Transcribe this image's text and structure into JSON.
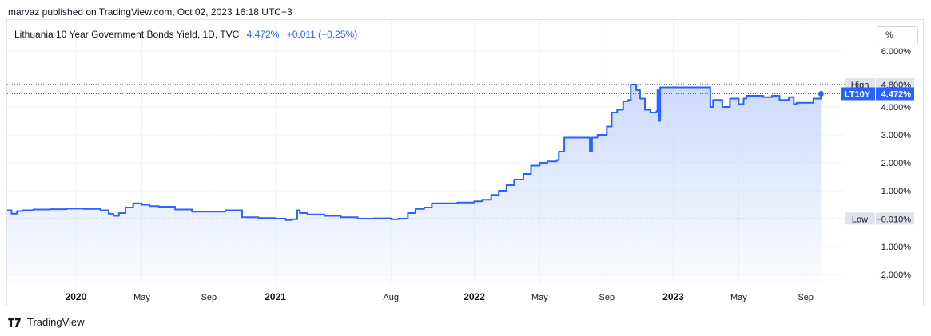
{
  "header": {
    "published": "marvaz published on TradingView.com, Oct 02, 2023 16:18 UTC+3"
  },
  "legend": {
    "name": "Lithuania 10 Year Government Bonds Yield, 1D, TVC",
    "value": "4.472%",
    "change": "+0.011 (+0.25%)"
  },
  "scale_button": "%",
  "footer": {
    "brand": "TradingView"
  },
  "colors": {
    "line": "#2962ff",
    "area_top": "#c3d3fa",
    "grid": "#f0f3fa",
    "label_bg": "#e0e3eb"
  },
  "chart_data": {
    "type": "area",
    "symbol": "LT10Y",
    "title": "Lithuania 10 Year Government Bonds Yield, 1D, TVC",
    "y_unit": "%",
    "ylim": [
      -2.3,
      6.3
    ],
    "y_ticks": [
      "6.000%",
      "4.000%",
      "3.000%",
      "2.000%",
      "1.000%",
      "−1.000%",
      "−2.000%"
    ],
    "y_tick_values": [
      6,
      4,
      3,
      2,
      1,
      -1,
      -2
    ],
    "x_ticks": [
      "2020",
      "May",
      "Sep",
      "2021",
      "Aug",
      "2022",
      "May",
      "Sep",
      "2023",
      "May",
      "Sep"
    ],
    "x_tick_dates": [
      "2020-01-01",
      "2020-05-01",
      "2020-09-01",
      "2021-01-01",
      "2021-08-01",
      "2022-01-01",
      "2022-05-01",
      "2022-09-01",
      "2023-01-01",
      "2023-05-01",
      "2023-09-01"
    ],
    "x_bold_ticks": [
      "2020",
      "2021",
      "2022",
      "2023"
    ],
    "xlim": [
      "2019-08-28",
      "2023-11-10"
    ],
    "high": {
      "label": "High",
      "value": "4.800%",
      "y": 4.8
    },
    "low": {
      "label": "Low",
      "value": "−0.010%",
      "y": -0.01
    },
    "last": {
      "label": "LT10Y",
      "value": "4.472%",
      "y": 4.472,
      "date": "2023-09-29"
    },
    "series": [
      {
        "x": [
          "2019-08-28",
          "2019-09-05",
          "2019-09-15",
          "2019-09-25",
          "2019-10-15",
          "2019-11-15",
          "2019-12-15",
          "2020-01-15",
          "2020-02-15",
          "2020-03-01",
          "2020-03-10",
          "2020-03-20",
          "2020-04-01",
          "2020-04-15",
          "2020-05-01",
          "2020-05-15",
          "2020-06-01",
          "2020-07-01",
          "2020-08-01",
          "2020-09-01",
          "2020-10-01",
          "2020-10-20",
          "2020-11-01",
          "2020-12-01",
          "2021-01-01",
          "2021-01-20",
          "2021-02-01",
          "2021-02-10",
          "2021-02-15",
          "2021-03-01",
          "2021-04-01",
          "2021-05-01",
          "2021-06-01",
          "2021-07-01",
          "2021-08-01",
          "2021-08-15",
          "2021-09-01",
          "2021-09-15",
          "2021-10-01",
          "2021-10-15",
          "2021-11-01",
          "2021-12-01",
          "2022-01-01",
          "2022-01-15",
          "2022-02-01",
          "2022-02-15",
          "2022-03-01",
          "2022-03-15",
          "2022-04-01",
          "2022-04-15",
          "2022-05-01",
          "2022-05-15",
          "2022-06-01",
          "2022-06-05",
          "2022-06-15",
          "2022-07-01",
          "2022-07-10",
          "2022-08-01",
          "2022-08-05",
          "2022-08-15",
          "2022-09-01",
          "2022-09-10",
          "2022-09-20",
          "2022-10-01",
          "2022-10-10",
          "2022-10-15",
          "2022-10-18",
          "2022-10-25",
          "2022-11-01",
          "2022-11-10",
          "2022-11-20",
          "2022-12-01",
          "2022-12-03",
          "2022-12-05",
          "2022-12-08",
          "2022-12-10",
          "2022-12-12",
          "2022-12-15",
          "2023-01-01",
          "2023-02-01",
          "2023-03-01",
          "2023-03-10",
          "2023-03-15",
          "2023-04-01",
          "2023-04-15",
          "2023-05-01",
          "2023-05-10",
          "2023-05-15",
          "2023-06-01",
          "2023-06-15",
          "2023-07-01",
          "2023-07-15",
          "2023-08-01",
          "2023-08-10",
          "2023-08-15",
          "2023-09-01",
          "2023-09-15",
          "2023-09-29"
        ],
        "y": [
          0.3,
          0.18,
          0.27,
          0.3,
          0.33,
          0.34,
          0.36,
          0.35,
          0.3,
          0.18,
          0.1,
          0.2,
          0.4,
          0.55,
          0.5,
          0.45,
          0.43,
          0.33,
          0.25,
          0.25,
          0.3,
          0.3,
          0.05,
          0.02,
          0.0,
          -0.05,
          -0.02,
          0.3,
          0.2,
          0.15,
          0.1,
          0.05,
          0.0,
          0.01,
          -0.02,
          0.0,
          0.2,
          0.35,
          0.4,
          0.55,
          0.55,
          0.58,
          0.62,
          0.68,
          0.85,
          1.0,
          1.2,
          1.4,
          1.6,
          1.9,
          2.0,
          2.05,
          2.1,
          2.4,
          2.9,
          2.9,
          2.9,
          2.4,
          2.9,
          3.0,
          3.3,
          3.8,
          3.9,
          4.2,
          4.25,
          4.8,
          4.8,
          4.6,
          4.3,
          3.9,
          3.8,
          3.85,
          4.6,
          3.5,
          4.7,
          4.7,
          4.7,
          4.7,
          4.7,
          4.7,
          4.7,
          4.0,
          4.25,
          4.0,
          4.3,
          4.1,
          4.3,
          4.4,
          4.4,
          4.35,
          4.4,
          4.25,
          4.35,
          4.1,
          4.15,
          4.15,
          4.3,
          4.472
        ]
      }
    ]
  }
}
